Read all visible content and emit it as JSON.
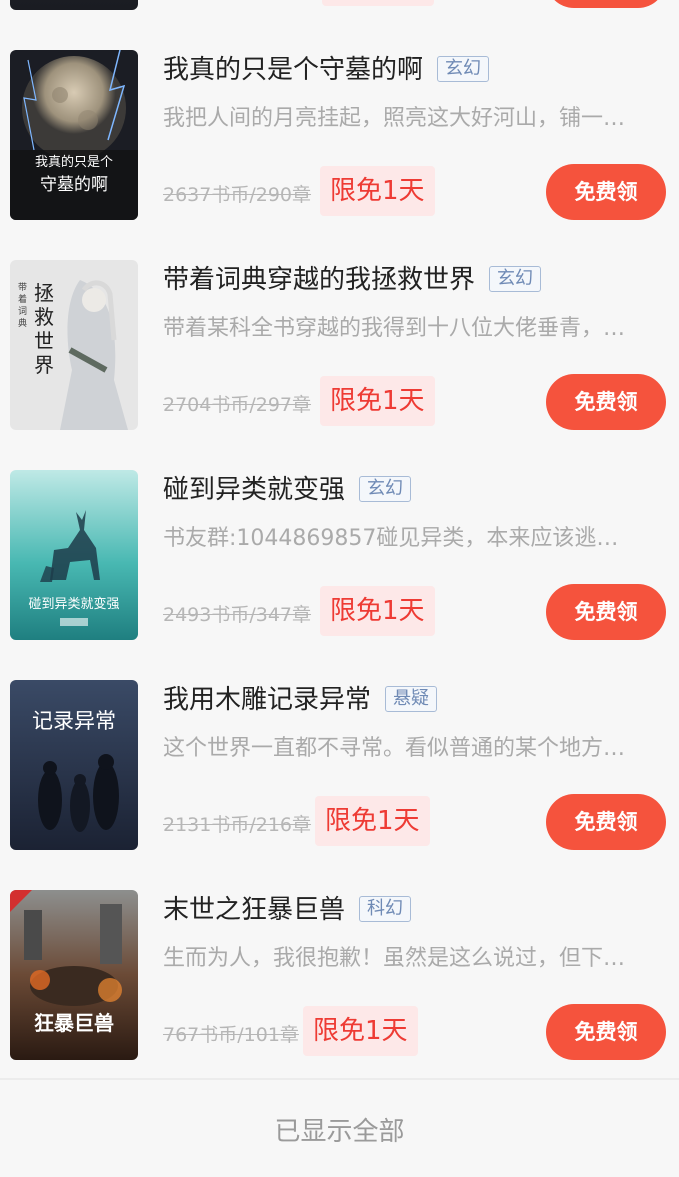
{
  "books": [
    {
      "title": "我真的只是个守墓的啊",
      "genre": "玄幻",
      "description": "我把人间的月亮挂起，照亮这大好河山，铺一…",
      "original_price": "2637书币/290章",
      "promo": "限免1天",
      "action": "免费领",
      "cover_text": "我真的只是个守墓的啊"
    },
    {
      "title": "带着词典穿越的我拯救世界",
      "genre": "玄幻",
      "description": "带着某科全书穿越的我得到十八位大佬垂青，…",
      "original_price": "2704书币/297章",
      "promo": "限免1天",
      "action": "免费领",
      "cover_text": "拯救世界"
    },
    {
      "title": "碰到异类就变强",
      "genre": "玄幻",
      "description": "书友群:1044869857碰见异类，本来应该逃…",
      "original_price": "2493书币/347章",
      "promo": "限免1天",
      "action": "免费领",
      "cover_text": "碰到异类就变强"
    },
    {
      "title": "我用木雕记录异常",
      "genre": "悬疑",
      "description": "这个世界一直都不寻常。看似普通的某个地方…",
      "original_price": "2131书币/216章",
      "promo": "限免1天",
      "action": "免费领",
      "cover_text": "记录异常"
    },
    {
      "title": "末世之狂暴巨兽",
      "genre": "科幻",
      "description": "生而为人，我很抱歉！虽然是这么说过，但下…",
      "original_price": "767书币/101章",
      "promo": "限免1天",
      "action": "免费领",
      "cover_text": "狂暴巨兽"
    }
  ],
  "footer": "已显示全部",
  "colors": {
    "accent": "#f5533d",
    "promo_text": "#ee3b34",
    "promo_bg": "#fde8e8",
    "genre_text": "#6f8ab5"
  }
}
